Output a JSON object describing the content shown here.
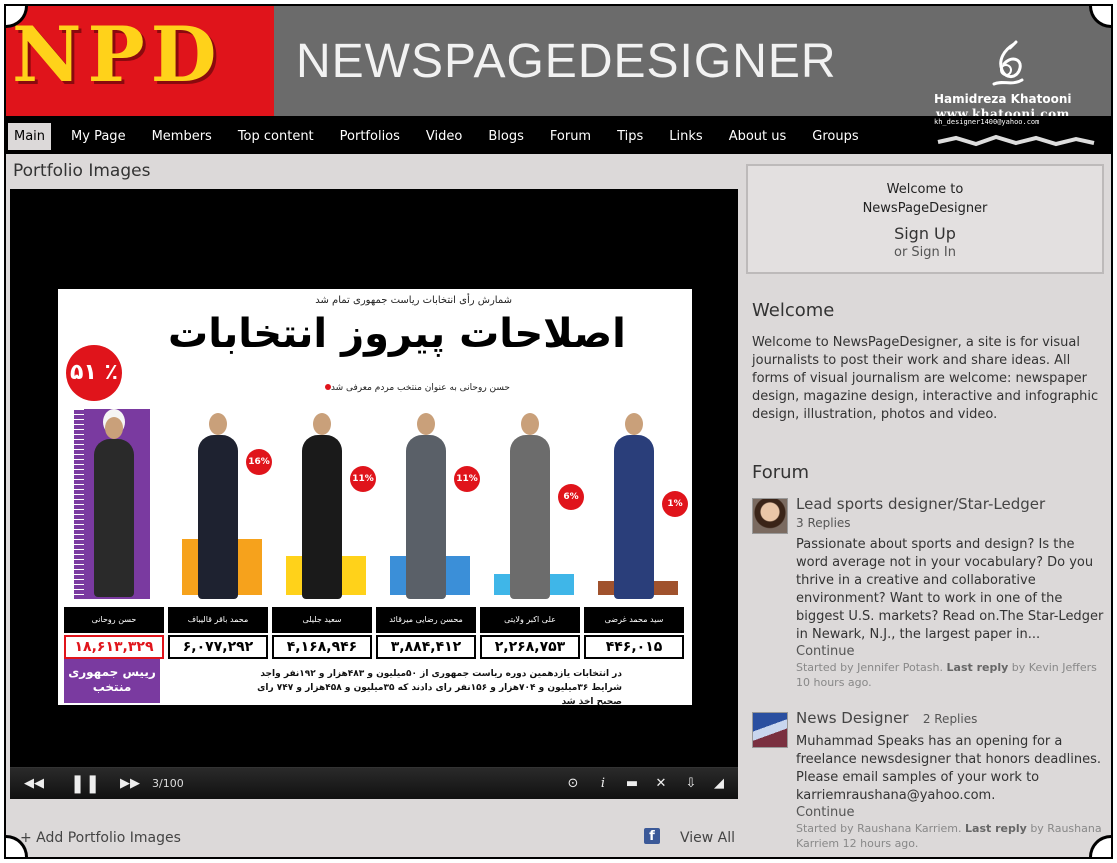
{
  "header": {
    "logo": "NPD",
    "site_name": "NEWSPAGEDESIGNER",
    "signature_name": "Hamidreza Khatooni",
    "signature_web": "www.khatooni.com",
    "signature_email": "kh_designer1400@yahoo.com"
  },
  "nav": {
    "items": [
      {
        "label": "Main",
        "active": true
      },
      {
        "label": "My Page"
      },
      {
        "label": "Members"
      },
      {
        "label": "Top content"
      },
      {
        "label": "Portfolios"
      },
      {
        "label": "Video"
      },
      {
        "label": "Blogs"
      },
      {
        "label": "Forum"
      },
      {
        "label": "Tips"
      },
      {
        "label": "Links"
      },
      {
        "label": "About us"
      },
      {
        "label": "Groups"
      }
    ]
  },
  "main": {
    "section_title": "Portfolio Images",
    "poster": {
      "top_line": "شمارش رأی انتخابات ریاست جمهوری تمام شد",
      "headline": "اصلاحات پیروز انتخابات",
      "subline": "حسن روحانی به عنوان منتخب مردم معرفی شد",
      "big_percent": "۵۱ ٪",
      "winner_title": "رییس جمهوری منتخب",
      "candidates": [
        {
          "name": "حسن روحانی",
          "votes": "۱۸,۶۱۳,۳۲۹",
          "percent": "51"
        },
        {
          "name": "محمد باقر قالیباف",
          "votes": "۶,۰۷۷,۲۹۲",
          "percent": "16"
        },
        {
          "name": "سعید جلیلی",
          "votes": "۴,۱۶۸,۹۴۶",
          "percent": "11"
        },
        {
          "name": "محسن رضایی میرقائد",
          "votes": "۳,۸۸۴,۴۱۲",
          "percent": "11"
        },
        {
          "name": "علی اکبر ولایتی",
          "votes": "۲,۲۶۸,۷۵۳",
          "percent": "6"
        },
        {
          "name": "سید محمد غرضی",
          "votes": "۴۴۶,۰۱۵",
          "percent": "1"
        }
      ],
      "footer": "در انتخابات یازدهمین دوره ریاست جمهوری از ۵۰میلیون و ۴۸۳هزار و ۱۹۲نفر واجد شرایط ۳۶میلیون و ۷۰۴هزار و ۱۵۶نفر رای دادند که ۳۵میلیون و ۴۵۸هزار و ۷۴۷ رای صحیح اخذ شد"
    },
    "controls": {
      "counter": "3/100"
    },
    "add_link": "+ Add Portfolio Images",
    "view_all": "View All"
  },
  "sidebar": {
    "welcome_box": {
      "line1": "Welcome to",
      "line2": "NewsPageDesigner",
      "signup": "Sign Up",
      "signin": "or Sign In"
    },
    "welcome_heading": "Welcome",
    "welcome_text": "Welcome to NewsPageDesigner, a site is for visual journalists to post their work and share ideas. All forms of visual journalism are welcome: newspaper design, magazine design, interactive and infographic design, illustration, photos and video.",
    "forum_heading": "Forum",
    "forum_items": [
      {
        "title": "Lead sports designer/Star-Ledger",
        "replies": "3 Replies",
        "text": "Passionate about sports and design? Is the word average not in your vocabulary? Do you thrive in a creative and collaborative environment? Want to work in one of the biggest U.S. markets? Read on.The Star-Ledger in Newark, N.J., the largest paper in...",
        "continue": "Continue",
        "started": "Started by Jennifer Potash.",
        "last_reply_label": "Last reply",
        "last_reply": "by Kevin Jeffers 10 hours ago."
      },
      {
        "title": "News Designer",
        "replies": "2 Replies",
        "text": "Muhammad Speaks has an opening for a freelance newsdesigner that honors deadlines. Please email samples of your work to karriemraushana@yahoo.com.",
        "continue": "Continue",
        "started": "Started by Raushana Karriem.",
        "last_reply_label": "Last reply",
        "last_reply": "by Raushana Karriem 12 hours ago."
      }
    ]
  },
  "colors": {
    "brand_red": "#e0141b",
    "logo_yellow": "#ffd21a",
    "header_gray": "#6b6b6b",
    "page_bg": "#dcd9d9",
    "winner_purple": "#7a3aa0"
  }
}
